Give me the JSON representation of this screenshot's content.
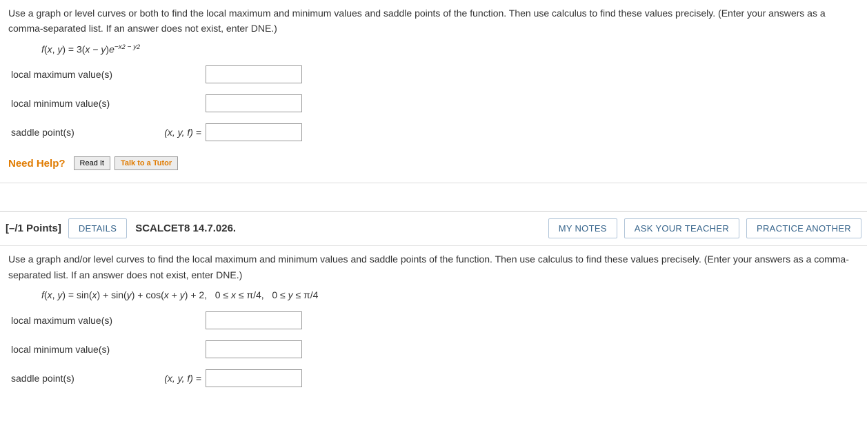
{
  "q1": {
    "prompt": "Use a graph or level curves or both to find the local maximum and minimum values and saddle points of the function. Then use calculus to find these values precisely. (Enter your answers as a comma-separated list. If an answer does not exist, enter DNE.)",
    "rows": {
      "localMax": {
        "label": "local maximum value(s)",
        "value": ""
      },
      "localMin": {
        "label": "local minimum value(s)",
        "value": ""
      },
      "saddle": {
        "label": "saddle point(s)",
        "prefix": "(x, y, f) =",
        "value": ""
      }
    },
    "help": {
      "title": "Need Help?",
      "readIt": "Read It",
      "talk": "Talk to a Tutor"
    }
  },
  "q2": {
    "header": {
      "points": "[–/1 Points]",
      "details": "DETAILS",
      "ref": "SCALCET8 14.7.026.",
      "myNotes": "MY NOTES",
      "ask": "ASK YOUR TEACHER",
      "practice": "PRACTICE ANOTHER"
    },
    "prompt": "Use a graph and/or level curves to find the local maximum and minimum values and saddle points of the function. Then use calculus to find these values precisely. (Enter your answers as a comma-separated list. If an answer does not exist, enter DNE.)",
    "rows": {
      "localMax": {
        "label": "local maximum value(s)",
        "value": ""
      },
      "localMin": {
        "label": "local minimum value(s)",
        "value": ""
      },
      "saddle": {
        "label": "saddle point(s)",
        "prefix": "(x, y, f) =",
        "value": ""
      }
    }
  },
  "chart_data": null
}
